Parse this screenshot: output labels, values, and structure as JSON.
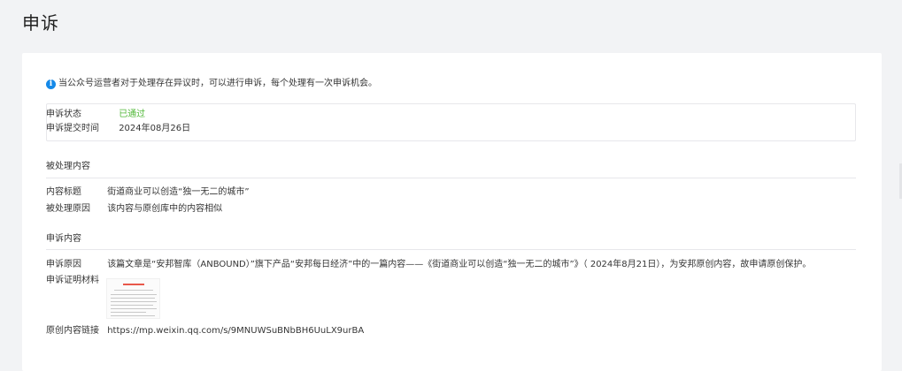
{
  "page": {
    "title": "申诉"
  },
  "notice": {
    "icon": "info-icon",
    "text": "当公众号运营者对于处理存在异议时，可以进行申诉，每个处理有一次申诉机会。"
  },
  "status": {
    "state_label": "申诉状态",
    "state_value": "已通过",
    "state_color": "#52b839",
    "time_label": "申诉提交时间",
    "time_value": "2024年08月26日"
  },
  "processed": {
    "section_title": "被处理内容",
    "title_label": "内容标题",
    "title_value": "街道商业可以创造“独一无二的城市”",
    "reason_label": "被处理原因",
    "reason_value": "该内容与原创库中的内容相似"
  },
  "appeal": {
    "section_title": "申诉内容",
    "reason_label": "申诉原因",
    "reason_value": "该篇文章是“安邦智库（ANBOUND）”旗下产品“安邦每日经济”中的一篇内容——《街道商业可以创造“独一无二的城市”》（ 2024年8月21日），为安邦原创内容，故申请原创保护。",
    "evidence_label": "申诉证明材料",
    "link_label": "原创内容链接",
    "link_value": "https://mp.weixin.qq.com/s/9MNUWSuBNbBH6UuLX9urBA"
  }
}
